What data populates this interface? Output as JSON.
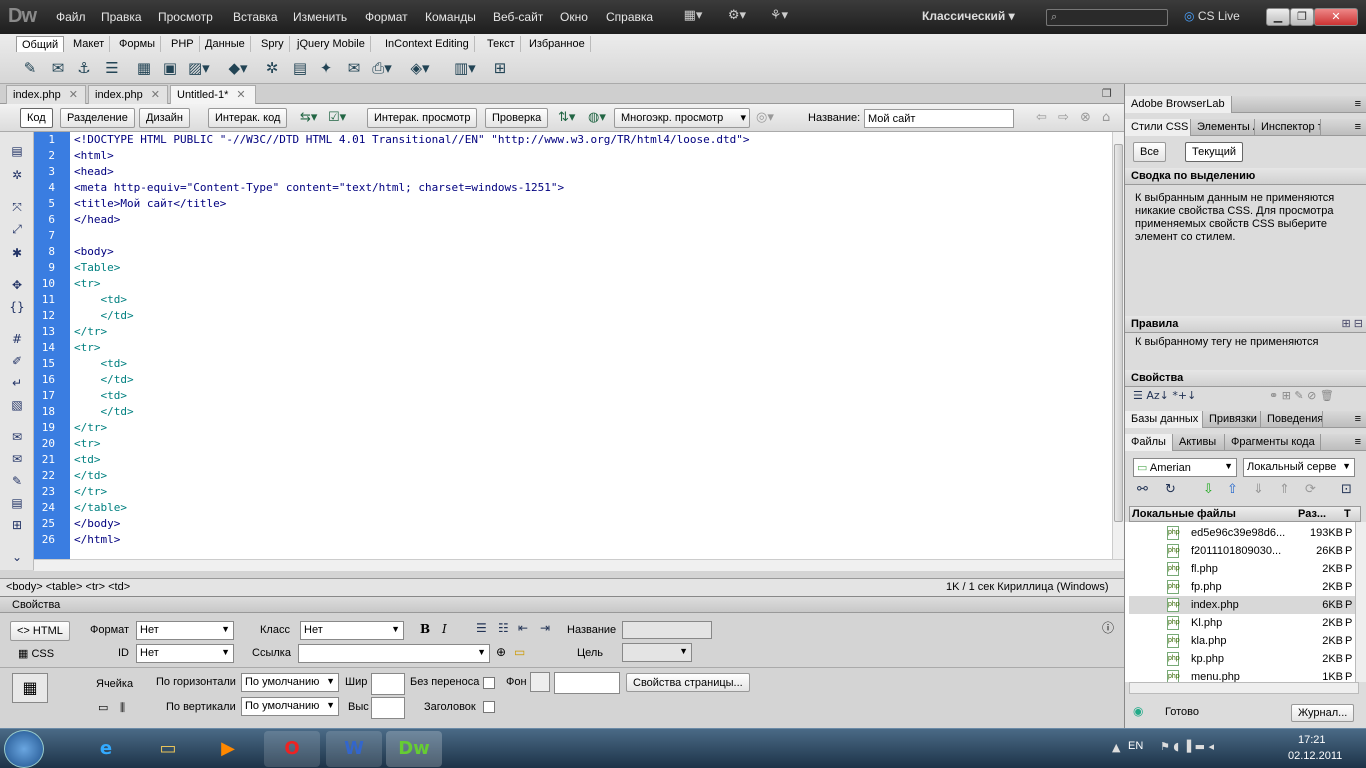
{
  "app": {
    "logo": "Dw",
    "workspace": "Классический",
    "cslive": "CS Live"
  },
  "menu": [
    "Файл",
    "Правка",
    "Просмотр",
    "Вставка",
    "Изменить",
    "Формат",
    "Команды",
    "Веб-сайт",
    "Окно",
    "Справка"
  ],
  "insert_tabs": [
    "Общий",
    "Макет",
    "Формы",
    "PHP",
    "Данные",
    "Spry",
    "jQuery Mobile",
    "InContext Editing",
    "Текст",
    "Избранное"
  ],
  "doc_tabs": [
    "index.php",
    "index.php",
    "Untitled-1*"
  ],
  "doc_toolbar": {
    "code": "Код",
    "split": "Разделение",
    "design": "Дизайн",
    "live_code": "Интерак. код",
    "live_view": "Интерак. просмотр",
    "inspect": "Проверка",
    "multiscreen": "Многоэкр. просмотр",
    "title_label": "Название:",
    "title_value": "Мой сайт"
  },
  "code_lines": [
    {
      "n": "1",
      "t": "<!DOCTYPE HTML PUBLIC \"-//W3C//DTD HTML 4.01 Transitional//EN\" \"http://www.w3.org/TR/html4/loose.dtd\">",
      "c": "tg"
    },
    {
      "n": "2",
      "t": "<html>",
      "c": "tg"
    },
    {
      "n": "3",
      "t": "<head>",
      "c": "tg"
    },
    {
      "n": "4",
      "t": "<meta http-equiv=\"Content-Type\" content=\"text/html; charset=windows-1251\">",
      "c": "tg"
    },
    {
      "n": "5",
      "t": "<title>Мой сайт</title>",
      "c": "tg"
    },
    {
      "n": "6",
      "t": "</head>",
      "c": "tg"
    },
    {
      "n": "7",
      "t": "",
      "c": "tg"
    },
    {
      "n": "8",
      "t": "<body>",
      "c": "tg"
    },
    {
      "n": "9",
      "t": "<Table>",
      "c": "tg2"
    },
    {
      "n": "10",
      "t": "<tr>",
      "c": "tg2"
    },
    {
      "n": "11",
      "t": "    <td>",
      "c": "tg2"
    },
    {
      "n": "12",
      "t": "    </td>",
      "c": "tg2"
    },
    {
      "n": "13",
      "t": "</tr>",
      "c": "tg2"
    },
    {
      "n": "14",
      "t": "<tr>",
      "c": "tg2"
    },
    {
      "n": "15",
      "t": "    <td>",
      "c": "tg2"
    },
    {
      "n": "16",
      "t": "    </td>",
      "c": "tg2"
    },
    {
      "n": "17",
      "t": "    <td>",
      "c": "tg2"
    },
    {
      "n": "18",
      "t": "    </td>",
      "c": "tg2"
    },
    {
      "n": "19",
      "t": "</tr>",
      "c": "tg2"
    },
    {
      "n": "20",
      "t": "<tr>",
      "c": "tg2"
    },
    {
      "n": "21",
      "t": "<td>",
      "c": "tg2"
    },
    {
      "n": "22",
      "t": "</td>",
      "c": "tg2"
    },
    {
      "n": "23",
      "t": "</tr>",
      "c": "tg2"
    },
    {
      "n": "24",
      "t": "</table>",
      "c": "tg2"
    },
    {
      "n": "25",
      "t": "</body>",
      "c": "tg"
    },
    {
      "n": "26",
      "t": "</html>",
      "c": "tg"
    }
  ],
  "status": {
    "breadcrumb": "<body> <table> <tr> <td>",
    "info": "1K / 1 сек  Кириллица (Windows)"
  },
  "props": {
    "title": "Свойства",
    "html_btn": "HTML",
    "css_btn": "CSS",
    "format_label": "Формат",
    "format_value": "Нет",
    "class_label": "Класс",
    "class_value": "Нет",
    "id_label": "ID",
    "id_value": "Нет",
    "link_label": "Ссылка",
    "name_label": "Название",
    "target_label": "Цель",
    "cell_label": "Ячейка",
    "horz_label": "По горизонтали",
    "horz_value": "По умолчанию",
    "vert_label": "По вертикали",
    "vert_value": "По умолчанию",
    "width_label": "Шир",
    "height_label": "Выс",
    "nowrap_label": "Без переноса",
    "header_label": "Заголовок",
    "bg_label": "Фон",
    "page_props": "Свойства страницы..."
  },
  "rpanel": {
    "browserlab": "Adobe BrowserLab",
    "css_tabs": [
      "Стили CSS",
      "Элементы AP",
      "Инспектор тегов"
    ],
    "all_btn": "Все",
    "current_btn": "Текущий",
    "summary_title": "Сводка по выделению",
    "summary_text": "К выбранным данным не применяются никакие свойства CSS.  Для просмотра применяемых свойств CSS выберите элемент со стилем.",
    "rules_title": "Правила",
    "rules_text": "К выбранному тегу не применяются",
    "props_title": "Свойства",
    "db_tabs": [
      "Базы данных",
      "Привязки",
      "Поведения"
    ],
    "file_tabs": [
      "Файлы",
      "Активы",
      "Фрагменты кода"
    ],
    "site": "Amerian",
    "view": "Локальный серве",
    "col_local": "Локальные файлы",
    "col_size": "Раз...",
    "col_type": "Т",
    "files": [
      {
        "name": "ed5e96c39e98d6...",
        "size": "193KB",
        "type": "P"
      },
      {
        "name": "f2011101809030...",
        "size": "26KB",
        "type": "P"
      },
      {
        "name": "fl.php",
        "size": "2KB",
        "type": "P"
      },
      {
        "name": "fp.php",
        "size": "2KB",
        "type": "P"
      },
      {
        "name": "index.php",
        "size": "6KB",
        "type": "P"
      },
      {
        "name": "Kl.php",
        "size": "2KB",
        "type": "P"
      },
      {
        "name": "kla.php",
        "size": "2KB",
        "type": "P"
      },
      {
        "name": "kp.php",
        "size": "2KB",
        "type": "P"
      },
      {
        "name": "menu.php",
        "size": "1KB",
        "type": "P"
      }
    ],
    "ready": "Готово",
    "log": "Журнал..."
  },
  "taskbar": {
    "lang": "EN",
    "time": "17:21",
    "date": "02.12.2011"
  },
  "colors": {
    "gutter": "#3a7de1",
    "tag": "#00007f",
    "table_tag": "#008080"
  }
}
